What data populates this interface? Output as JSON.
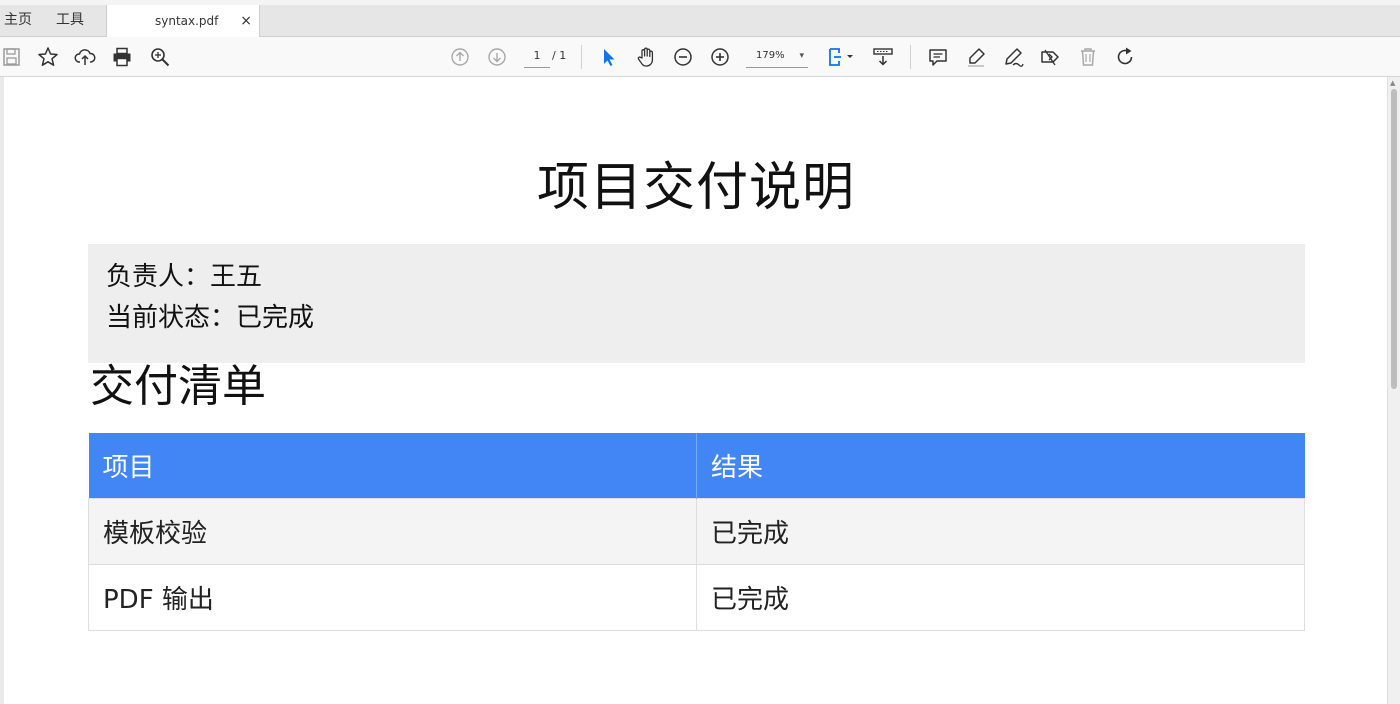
{
  "tabs": {
    "home_label": "主页",
    "tools_label": "工具",
    "document_name": "syntax.pdf",
    "close_glyph": "×"
  },
  "toolbar": {
    "page_current": "1",
    "page_total": "/ 1",
    "zoom_level": "179%",
    "zoom_arrow": "▾",
    "icons": [
      "save-icon",
      "bookmark-star-icon",
      "upload-cloud-icon",
      "print-icon",
      "search-icon",
      "prev-page-icon",
      "next-page-icon",
      "select-cursor-icon",
      "hand-tool-icon",
      "zoom-out-icon",
      "zoom-in-icon",
      "fit-page-icon",
      "scroll-mode-icon",
      "comment-icon",
      "highlight-icon",
      "draw-icon",
      "fill-sign-icon",
      "delete-icon",
      "rotate-icon"
    ],
    "accent_color": "#1473e6"
  },
  "document": {
    "title": "项目交付说明",
    "info": {
      "owner_line": "负责人：王五",
      "status_line": "当前状态：已完成"
    },
    "section_title": "交付清单",
    "table": {
      "headers": [
        "项目",
        "结果"
      ],
      "rows": [
        [
          "模板校验",
          "已完成"
        ],
        [
          "PDF 输出",
          "已完成"
        ]
      ],
      "header_color": "#4285f4"
    }
  }
}
